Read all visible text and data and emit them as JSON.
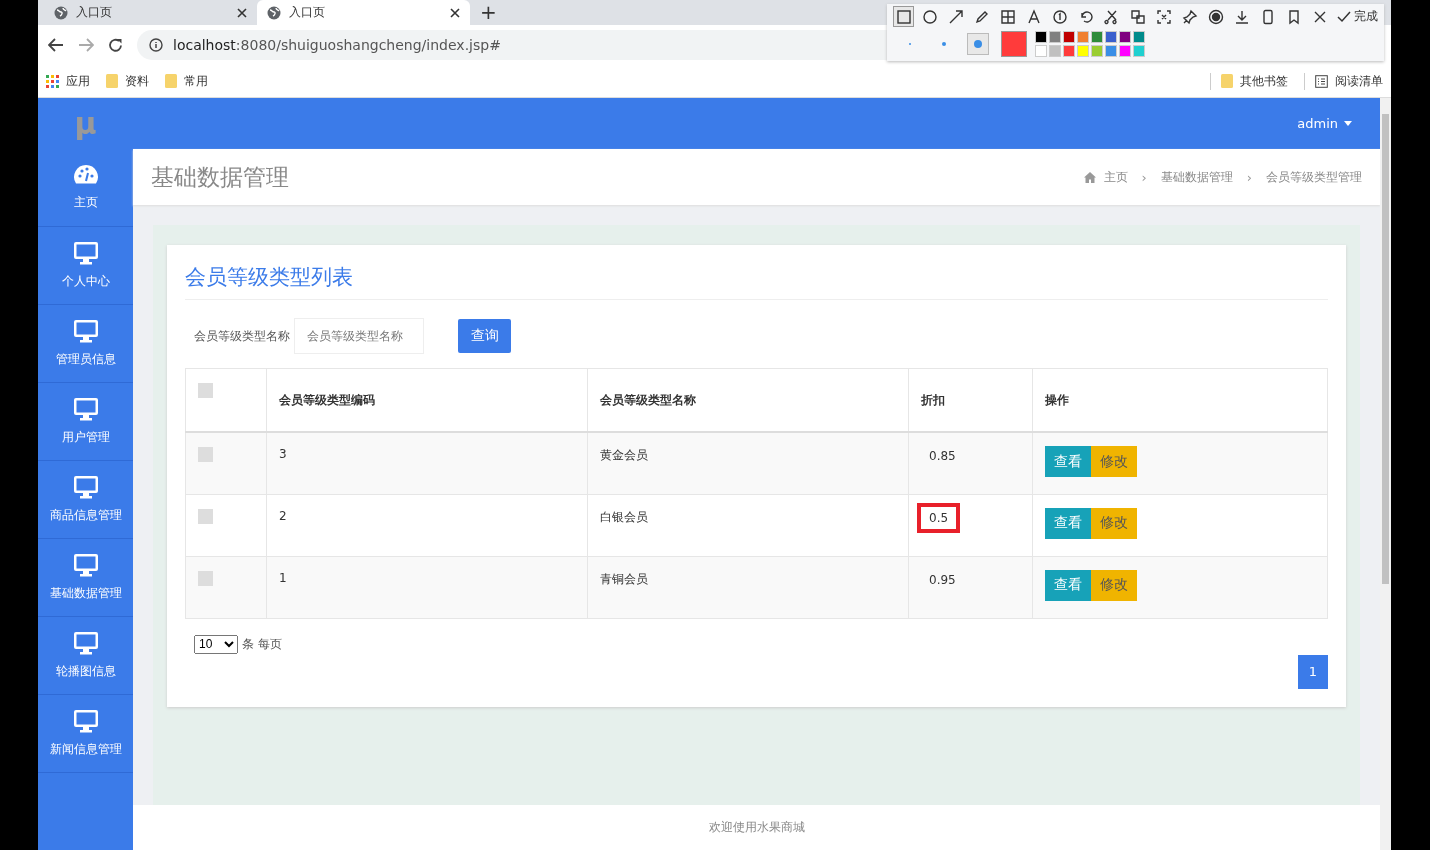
{
  "browser": {
    "tabs": [
      {
        "title": "入口页",
        "selected": false
      },
      {
        "title": "入口页",
        "selected": true
      }
    ],
    "new_tab": "+",
    "url_host": "localhost",
    "url_rest": ":8080/shuiguoshangcheng/index.jsp#",
    "bookmarks": [
      {
        "label": "应用",
        "kind": "apps"
      },
      {
        "label": "资料",
        "kind": "folder"
      },
      {
        "label": "常用",
        "kind": "folder"
      }
    ],
    "other_bookmarks": "其他书签",
    "reading_list": "阅读清单"
  },
  "annotation_toolbar": {
    "done_label": "完成",
    "brush_sizes": [
      {
        "selected": false
      },
      {
        "selected": false
      },
      {
        "selected": true
      }
    ],
    "palette": [
      {
        "color": "#000000",
        "selected": false
      },
      {
        "color": "#808080",
        "selected": false
      },
      {
        "color": "#c00000",
        "selected": false
      },
      {
        "color": "#f08030",
        "selected": false
      },
      {
        "color": "#2e8b3a",
        "selected": false
      },
      {
        "color": "#3a5fcd",
        "selected": false
      },
      {
        "color": "#800080",
        "selected": false
      },
      {
        "color": "#008b8b",
        "selected": false
      },
      {
        "color": "#ffffff",
        "selected": false
      },
      {
        "color": "#c0c0c0",
        "selected": false
      },
      {
        "color": "#ff3b3b",
        "selected": true
      },
      {
        "color": "#ffff00",
        "selected": false
      },
      {
        "color": "#9acd32",
        "selected": false
      },
      {
        "color": "#3a8ee6",
        "selected": false
      },
      {
        "color": "#ff00ff",
        "selected": false
      },
      {
        "color": "#20d0d0",
        "selected": false
      }
    ]
  },
  "app": {
    "logo": "μ",
    "user": "admin",
    "sidebar": [
      {
        "label": "主页",
        "kind": "dashboard"
      },
      {
        "label": "个人中心",
        "kind": "monitor"
      },
      {
        "label": "管理员信息",
        "kind": "monitor"
      },
      {
        "label": "用户管理",
        "kind": "monitor"
      },
      {
        "label": "商品信息管理",
        "kind": "monitor"
      },
      {
        "label": "基础数据管理",
        "kind": "monitor"
      },
      {
        "label": "轮播图信息",
        "kind": "monitor"
      },
      {
        "label": "新闻信息管理",
        "kind": "monitor"
      }
    ],
    "page_title": "基础数据管理",
    "breadcrumb": [
      "主页",
      "基础数据管理",
      "会员等级类型管理"
    ],
    "breadcrumb_separator": "›",
    "card_title": "会员等级类型列表",
    "search": {
      "label": "会员等级类型名称",
      "placeholder": "会员等级类型名称",
      "button": "查询"
    },
    "table": {
      "select_all_checked": false,
      "columns": [
        "会员等级类型编码",
        "会员等级类型名称",
        "折扣",
        "操作"
      ],
      "rows": [
        {
          "checked": false,
          "code": "3",
          "name": "黄金会员",
          "discount": "0.85",
          "marked": false,
          "actions": [
            "查看",
            "修改"
          ]
        },
        {
          "checked": false,
          "code": "2",
          "name": "白银会员",
          "discount": "0.5",
          "marked": true,
          "actions": [
            "查看",
            "修改"
          ]
        },
        {
          "checked": false,
          "code": "1",
          "name": "青铜会员",
          "discount": "0.95",
          "marked": false,
          "actions": [
            "查看",
            "修改"
          ]
        }
      ]
    },
    "page_size": "10",
    "per_page_label": "条 每页",
    "pages": [
      {
        "label": "1",
        "selected": true
      }
    ],
    "footer": "欢迎使用水果商城"
  }
}
